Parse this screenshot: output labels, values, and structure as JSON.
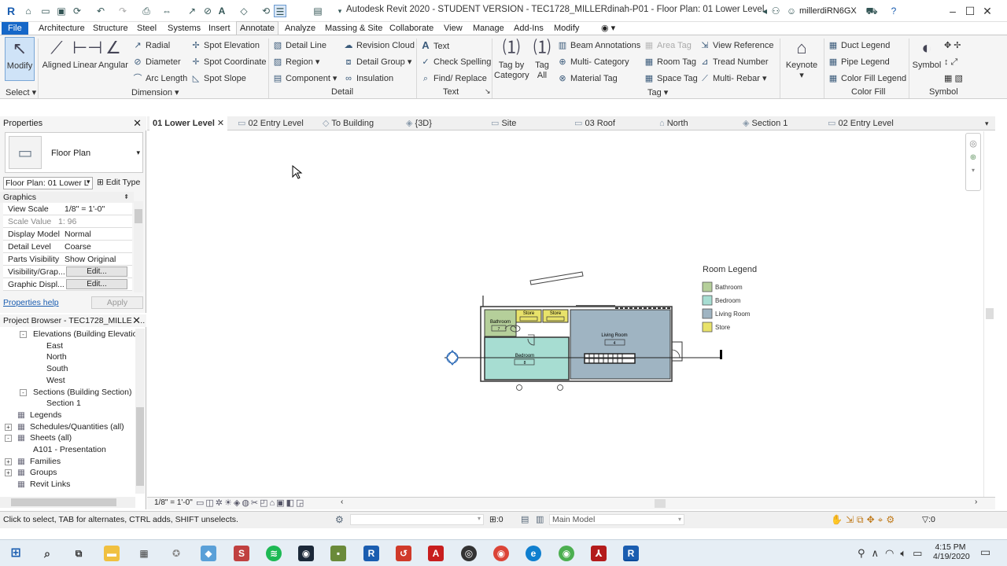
{
  "titlebar": {
    "title": "Autodesk Revit 2020 - STUDENT VERSION - TEC1728_MILLERdinah-P01 - Floor Plan: 01 Lower Level",
    "user": "millerdiRN6GX"
  },
  "ribbon_tabs": [
    "File",
    "Architecture",
    "Structure",
    "Steel",
    "Systems",
    "Insert",
    "Annotate",
    "Analyze",
    "Massing & Site",
    "Collaborate",
    "View",
    "Manage",
    "Add-Ins",
    "Modify"
  ],
  "active_tab": "Annotate",
  "ribbon": {
    "modify": "Modify",
    "select": "Select",
    "aligned": "Aligned",
    "linear": "Linear",
    "angular": "Angular",
    "radial": "Radial",
    "diameter": "Diameter",
    "arc_length": "Arc Length",
    "spot_elevation": "Spot Elevation",
    "spot_coordinate": "Spot Coordinate",
    "spot_slope": "Spot Slope",
    "dimension": "Dimension",
    "detail_line": "Detail Line",
    "region": "Region",
    "component": "Component",
    "revision_cloud": "Revision Cloud",
    "detail_group": "Detail Group",
    "insulation": "Insulation",
    "detail": "Detail",
    "text": "Text",
    "check_spelling": "Check Spelling",
    "find_replace": "Find/ Replace",
    "text_panel": "Text",
    "tag_by_category_1": "Tag by",
    "tag_by_category_2": "Category",
    "tag_all_1": "Tag",
    "tag_all_2": "All",
    "beam_annotations": "Beam Annotations",
    "multi_category": "Multi- Category",
    "material_tag": "Material Tag",
    "area_tag": "Area Tag",
    "room_tag": "Room Tag",
    "space_tag": "Space Tag",
    "view_reference": "View Reference",
    "tread_number": "Tread Number",
    "multi_rebar": "Multi- Rebar",
    "tag_panel": "Tag",
    "keynote": "Keynote",
    "duct_legend": "Duct Legend",
    "pipe_legend": "Pipe Legend",
    "color_fill_legend": "Color Fill Legend",
    "color_fill": "Color Fill",
    "symbol": "Symbol",
    "symbol_panel": "Symbol"
  },
  "view_tabs": [
    "01 Lower Level",
    "02 Entry Level",
    "To Building",
    "{3D}",
    "Site",
    "03 Roof",
    "North",
    "Section 1",
    "02 Entry Level"
  ],
  "properties": {
    "title": "Properties",
    "type": "Floor Plan",
    "selector": "Floor Plan: 01 Lower L",
    "edit_type": "Edit Type",
    "group": "Graphics",
    "rows": [
      {
        "k": "View Scale",
        "v": "1/8\" = 1'-0\""
      },
      {
        "k": "Scale Value",
        "v": "1:  96"
      },
      {
        "k": "Display Model",
        "v": "Normal"
      },
      {
        "k": "Detail Level",
        "v": "Coarse"
      },
      {
        "k": "Parts Visibility",
        "v": "Show Original"
      },
      {
        "k": "Visibility/Grap...",
        "v": "Edit..."
      },
      {
        "k": "Graphic Displ...",
        "v": "Edit..."
      }
    ],
    "help": "Properties help",
    "apply": "Apply"
  },
  "browser": {
    "title": "Project Browser - TEC1728_MILLER...",
    "items": [
      {
        "label": "Elevations (Building Elevatio",
        "level": 1,
        "toggle": "-"
      },
      {
        "label": "East",
        "level": 2
      },
      {
        "label": "North",
        "level": 2
      },
      {
        "label": "South",
        "level": 2
      },
      {
        "label": "West",
        "level": 2
      },
      {
        "label": "Sections (Building Section)",
        "level": 1,
        "toggle": "-"
      },
      {
        "label": "Section 1",
        "level": 2
      },
      {
        "label": "Legends",
        "level": 0
      },
      {
        "label": "Schedules/Quantities (all)",
        "level": 0,
        "toggle": "+"
      },
      {
        "label": "Sheets (all)",
        "level": 0,
        "toggle": "-"
      },
      {
        "label": "A101 - Presentation",
        "level": 1
      },
      {
        "label": "Families",
        "level": 0,
        "toggle": "+"
      },
      {
        "label": "Groups",
        "level": 0,
        "toggle": "+"
      },
      {
        "label": "Revit Links",
        "level": 0
      }
    ]
  },
  "legend": {
    "title": "Room Legend",
    "items": [
      {
        "label": "Bathroom",
        "color": "#b5cf9a"
      },
      {
        "label": "Bedroom",
        "color": "#a7ddd2"
      },
      {
        "label": "Living Room",
        "color": "#9fb4c2"
      },
      {
        "label": "Store",
        "color": "#e8e26a"
      }
    ]
  },
  "plan": {
    "store1": "Store",
    "store2": "Store",
    "bathroom": "Bathroom",
    "living_room": "Living Room",
    "bedroom": "Bedroom",
    "bathroom_num": "7",
    "living_num": "4",
    "bedroom_num": "8"
  },
  "viewbar": {
    "scale": "1/8\" = 1'-0\""
  },
  "status": {
    "hint": "Click to select, TAB for alternates, CTRL adds, SHIFT unselects.",
    "zero": ":0",
    "model": "Main Model",
    "filter": ":0"
  },
  "taskbar": {
    "time": "4:15 PM",
    "date": "4/19/2020"
  },
  "colors": {
    "accent": "#1567c8",
    "bathroom": "#b5cf9a",
    "bedroom": "#a7ddd2",
    "living": "#9fb4c2",
    "store": "#e8e26a"
  }
}
